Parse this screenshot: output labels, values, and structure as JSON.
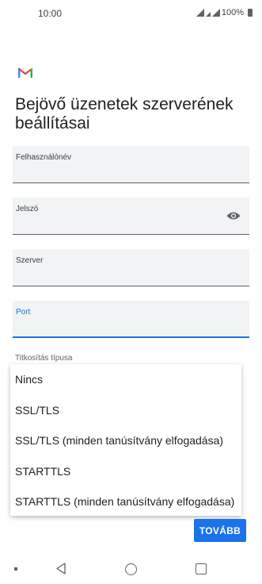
{
  "status": {
    "time": "10:00",
    "battery": "100%"
  },
  "icons": {
    "app": "gmail-icon",
    "password_toggle": "visibility-eye-icon"
  },
  "page": {
    "title": "Bejövő üzenetek szerverének beállításai"
  },
  "form": {
    "username_label": "Felhasználónév",
    "password_label": "Jelszó",
    "server_label": "Szerver",
    "port_label": "Port",
    "encryption_label": "Titkosítás típusa"
  },
  "dropdown": {
    "options": [
      "Nincs",
      "SSL/TLS",
      "SSL/TLS (minden tanúsítvány elfogadása)",
      "STARTTLS",
      "STARTTLS (minden tanúsítvány elfogadása)"
    ]
  },
  "actions": {
    "next_label": "TOVÁBB"
  },
  "colors": {
    "accent": "#1a73e8",
    "field_bg": "#f1f3f4"
  }
}
